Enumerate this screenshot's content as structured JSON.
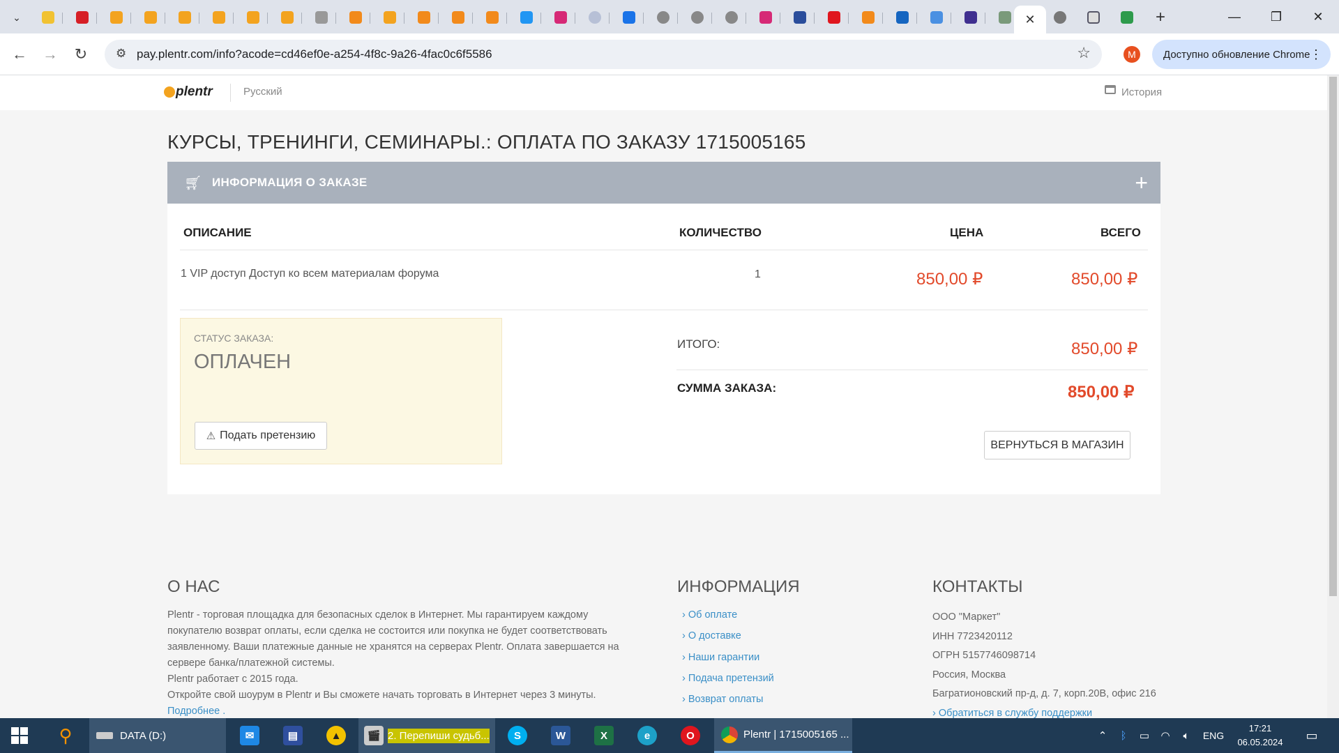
{
  "browser": {
    "tab_count_icons": [
      "chevron-down-icon",
      "gmail-icon",
      "red-flag-icon",
      "orange-chain-icon",
      "orange-chain-icon",
      "orange-chain-icon",
      "orange-chain-icon",
      "orange-chain-icon",
      "orange-chain-icon",
      "grey-chain-icon",
      "orange-cloud-icon",
      "orange-chain-icon",
      "orange-cloud-icon",
      "orange-cloud-icon",
      "orange-cloud-icon",
      "blue-doc-icon",
      "instagram-icon",
      "grey-a-icon",
      "chat-icon",
      "google-icon",
      "google-icon",
      "google-icon",
      "instagram-icon",
      "bird-icon",
      "red-record-icon",
      "orange-cloud-icon",
      "blue-wave-icon",
      "doc-icon",
      "list-icon",
      "globe-icon"
    ],
    "new_tab_label": "+",
    "url": "pay.plentr.com/info?acode=cd46ef0e-a254-4f8c-9a26-4fac0c6f5586",
    "profile_letter": "M",
    "update_label": "Доступно обновление Chrome"
  },
  "header": {
    "logo": "plentr",
    "language": "Русский",
    "history": "История"
  },
  "order": {
    "title": "КУРСЫ, ТРЕНИНГИ, СЕМИНАРЫ.: ОПЛАТА ПО ЗАКАЗУ 1715005165",
    "panel_title": "ИНФОРМАЦИЯ О ЗАКАЗЕ",
    "columns": [
      "ОПИСАНИЕ",
      "КОЛИЧЕСТВО",
      "ЦЕНА",
      "ВСЕГО"
    ],
    "item": {
      "description": "1 VIP доступ Доступ ко всем материалам форума",
      "quantity": "1",
      "price": "850,00 ₽",
      "total": "850,00 ₽"
    },
    "status_label": "СТАТУС ЗАКАЗА:",
    "status_value": "ОПЛАЧЕН",
    "claim_button": "Подать претензию",
    "subtotal_label": "ИТОГО:",
    "subtotal_value": "850,00 ₽",
    "sum_label": "СУММА ЗАКАЗА:",
    "sum_value": "850,00 ₽",
    "back_button": "ВЕРНУТЬСЯ В МАГАЗИН"
  },
  "footer": {
    "about_title": "О НАС",
    "about_text": "Plentr - торговая площадка для безопасных сделок в Интернет. Мы гарантируем каждому покупателю возврат оплаты, если сделка не состоится или покупка не будет соответствовать заявленному. Ваши платежные данные не хранятся на серверах Plentr. Оплата завершается на сервере банка/платежной системы.",
    "about_since": "Plentr работает с 2015 года.",
    "about_cta": "Откройте свой шоурум в Plentr и Вы сможете начать торговать в Интернет через 3 минуты.",
    "about_more": "Подробнее .",
    "info_title": "ИНФОРМАЦИЯ",
    "info_links": [
      "Об оплате",
      "О доставке",
      "Наши гарантии",
      "Подача претензий",
      "Возврат оплаты"
    ],
    "contacts_title": "КОНТАКТЫ",
    "contacts": [
      "ООО \"Маркет\"",
      "ИНН 7723420112",
      "ОГРН 5157746098714",
      "Россия, Москва",
      "Багратионовский пр-д, д. 7, корп.20В, офис 216"
    ],
    "support_link": "Обратиться в службу поддержки"
  },
  "taskbar": {
    "drive": "DATA (D:)",
    "media": "2. Перепиши судьб...",
    "chrome": "Plentr | 1715005165 ...",
    "lang": "ENG",
    "time": "17:21",
    "date": "06.05.2024"
  }
}
